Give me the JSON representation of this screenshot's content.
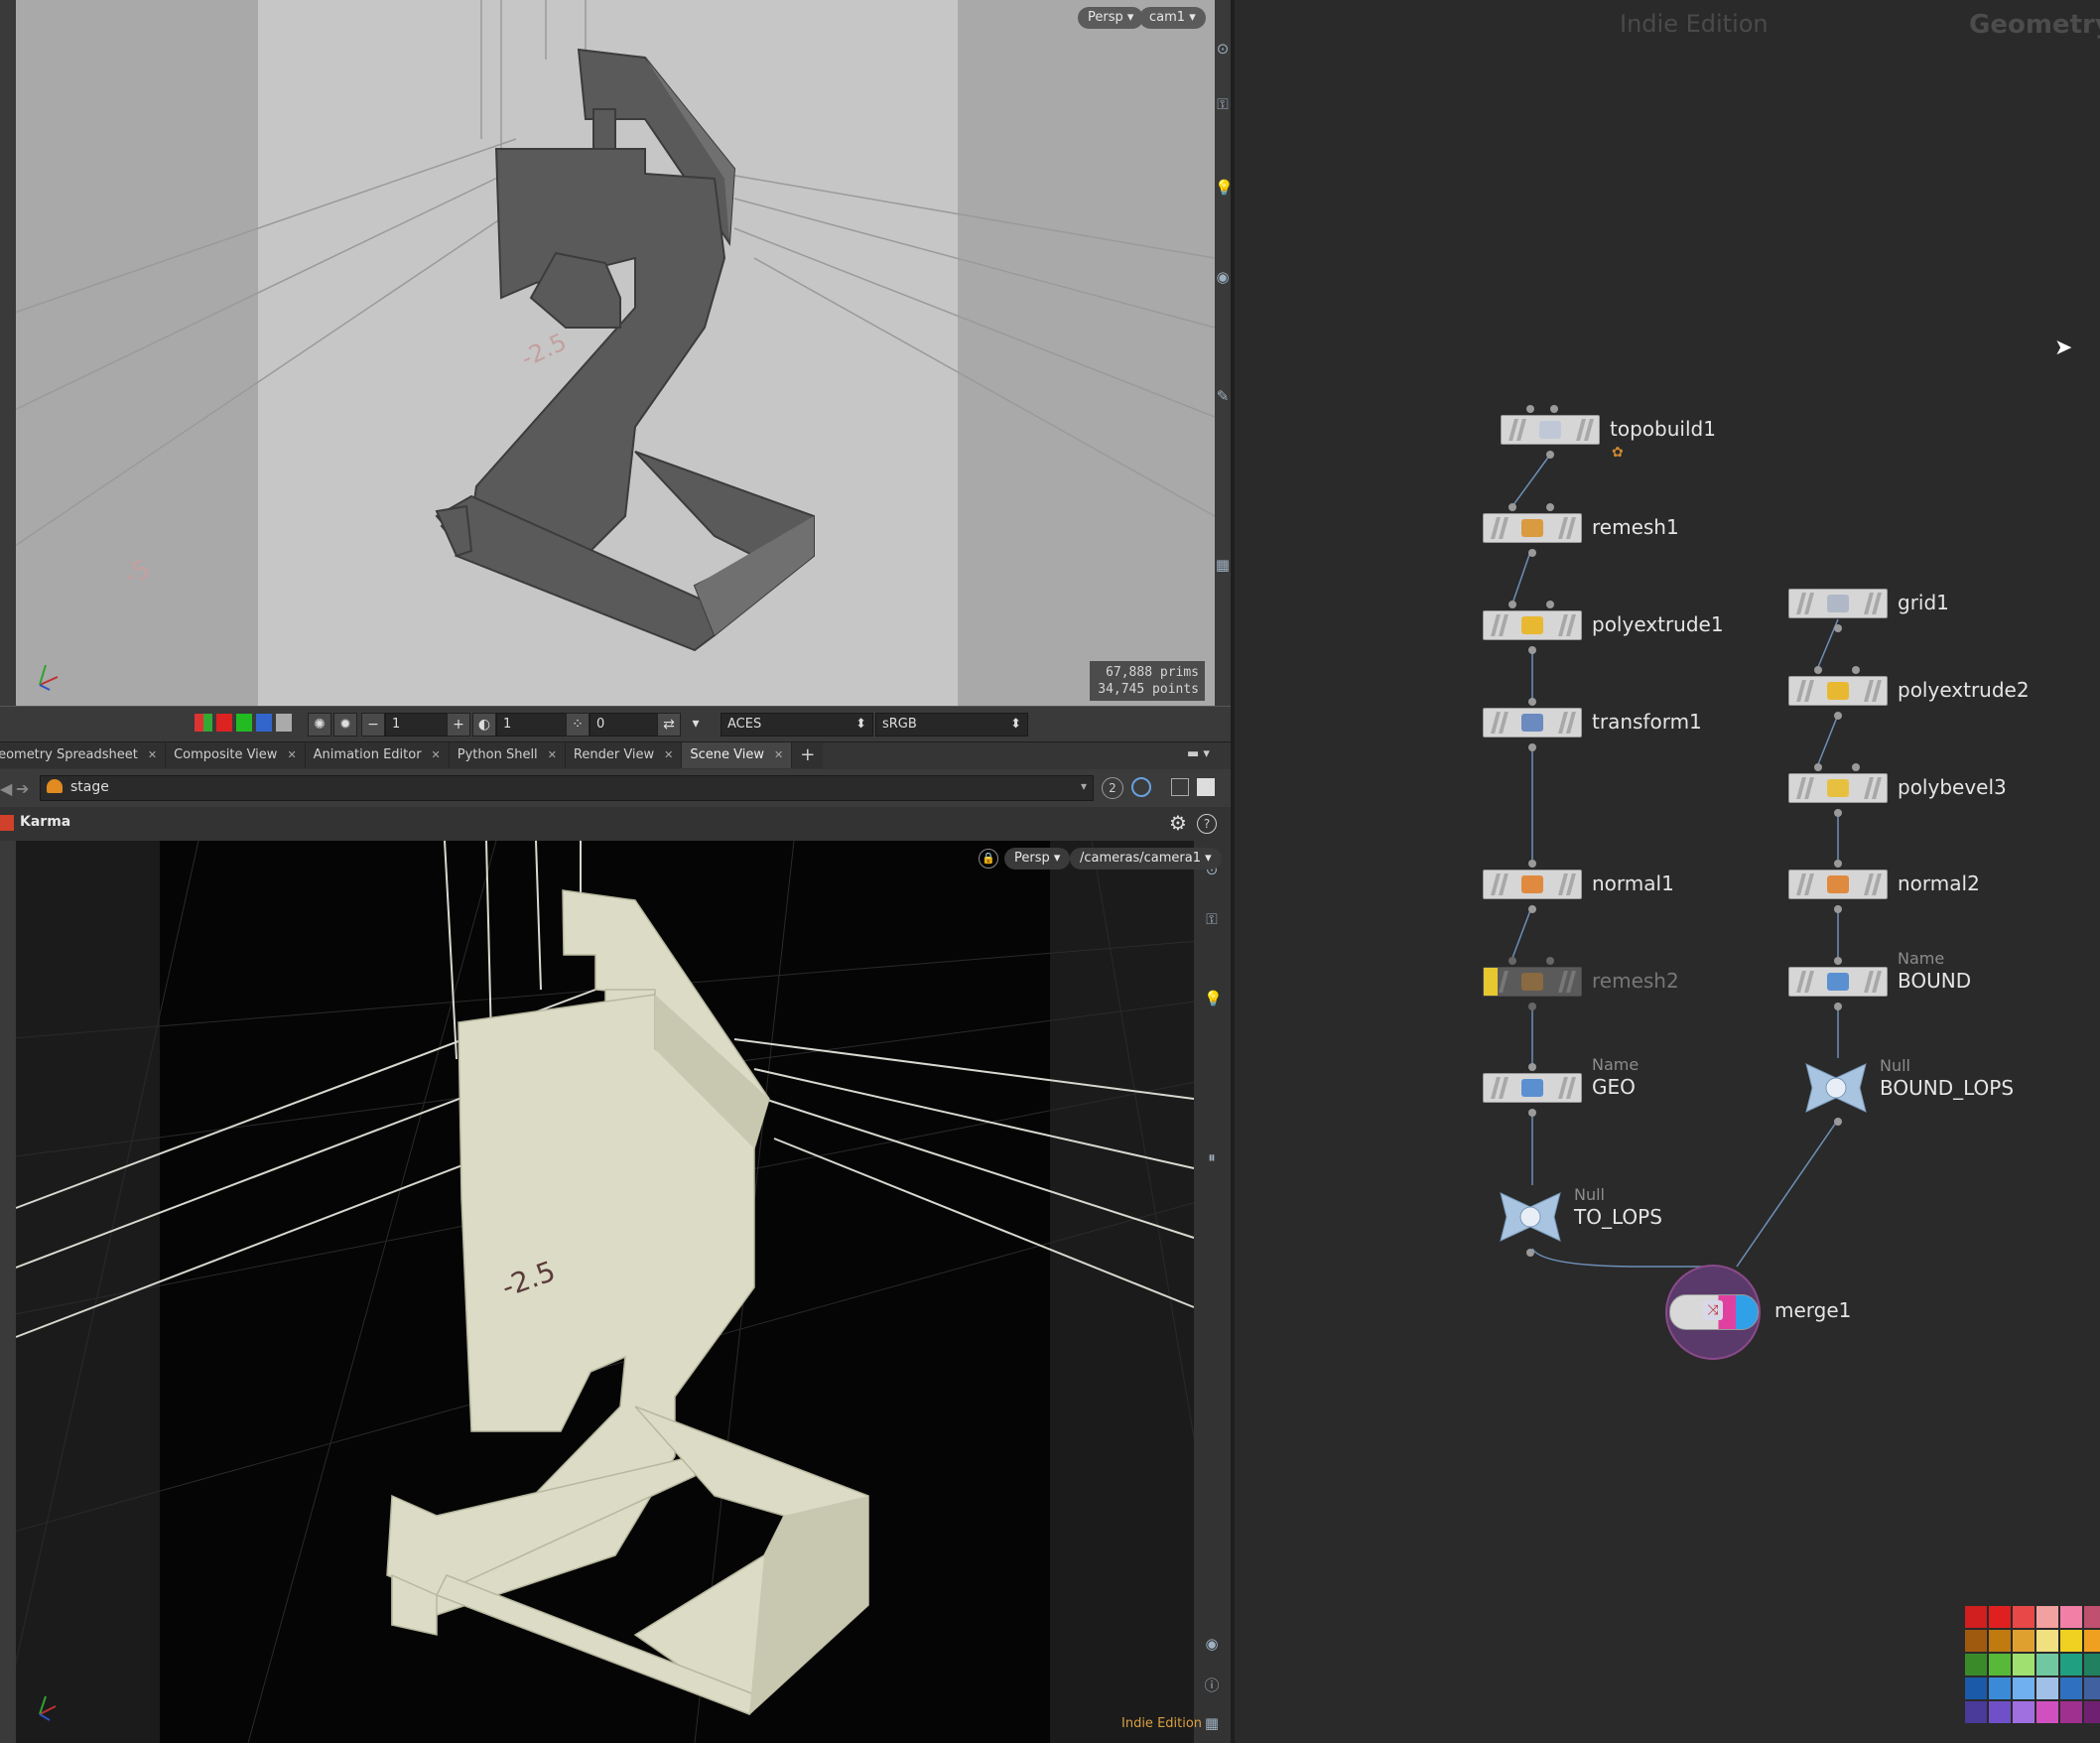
{
  "top_viewport": {
    "view_menu": "Persp",
    "camera_menu": "cam1",
    "stats": {
      "prims": "67,888  prims",
      "points": "34,745 points"
    },
    "ground_labels": [
      "-5",
      "-2.5"
    ]
  },
  "viewport_toolbar": {
    "frame_value": "1",
    "opacity_value": "1",
    "snap_value": "0",
    "color_space": "ACES",
    "display": "sRGB"
  },
  "tabs": [
    {
      "label": "Geometry Spreadsheet",
      "active": false
    },
    {
      "label": "Composite View",
      "active": false
    },
    {
      "label": "Animation Editor",
      "active": false
    },
    {
      "label": "Python Shell",
      "active": false
    },
    {
      "label": "Render View",
      "active": false
    },
    {
      "label": "Scene View",
      "active": true
    }
  ],
  "path": {
    "context": "stage",
    "badge": "2"
  },
  "render_bar": {
    "renderer": "Karma"
  },
  "bottom_viewport": {
    "view_menu": "Persp",
    "camera_menu": "/cameras/camera1",
    "watermark": "Indie Edition"
  },
  "network": {
    "watermark": "Indie Edition",
    "context_title": "Geometry",
    "nodes": [
      {
        "id": "topobuild1",
        "name": "topobuild1",
        "sub": ""
      },
      {
        "id": "remesh1",
        "name": "remesh1",
        "sub": ""
      },
      {
        "id": "polyextrude1",
        "name": "polyextrude1",
        "sub": ""
      },
      {
        "id": "transform1",
        "name": "transform1",
        "sub": ""
      },
      {
        "id": "normal1",
        "name": "normal1",
        "sub": ""
      },
      {
        "id": "remesh2",
        "name": "remesh2",
        "sub": ""
      },
      {
        "id": "geo",
        "name": "GEO",
        "sub": "Name"
      },
      {
        "id": "to_lops",
        "name": "TO_LOPS",
        "sub": "Null"
      },
      {
        "id": "grid1",
        "name": "grid1",
        "sub": ""
      },
      {
        "id": "polyextrude2",
        "name": "polyextrude2",
        "sub": ""
      },
      {
        "id": "polybevel3",
        "name": "polybevel3",
        "sub": ""
      },
      {
        "id": "normal2",
        "name": "normal2",
        "sub": ""
      },
      {
        "id": "bound",
        "name": "BOUND",
        "sub": "Name"
      },
      {
        "id": "bound_lops",
        "name": "BOUND_LOPS",
        "sub": "Null"
      },
      {
        "id": "merge1",
        "name": "merge1",
        "sub": ""
      }
    ],
    "palette": [
      "#d11e1e",
      "#e02020",
      "#e84848",
      "#f2a0a0",
      "#f27fa6",
      "#c05070",
      "#a05a10",
      "#c07a10",
      "#e0a030",
      "#f0e080",
      "#f0d020",
      "#f0a020",
      "#3a8a2a",
      "#58b838",
      "#a0e070",
      "#70c8a0",
      "#20a080",
      "#208060",
      "#1a5aa8",
      "#3a8ad8",
      "#70b0f0",
      "#a0c0e8",
      "#3070c0",
      "#4060a0",
      "#4a3a9a",
      "#7050c8",
      "#a070e0",
      "#d050c0",
      "#a03090",
      "#702070"
    ]
  }
}
